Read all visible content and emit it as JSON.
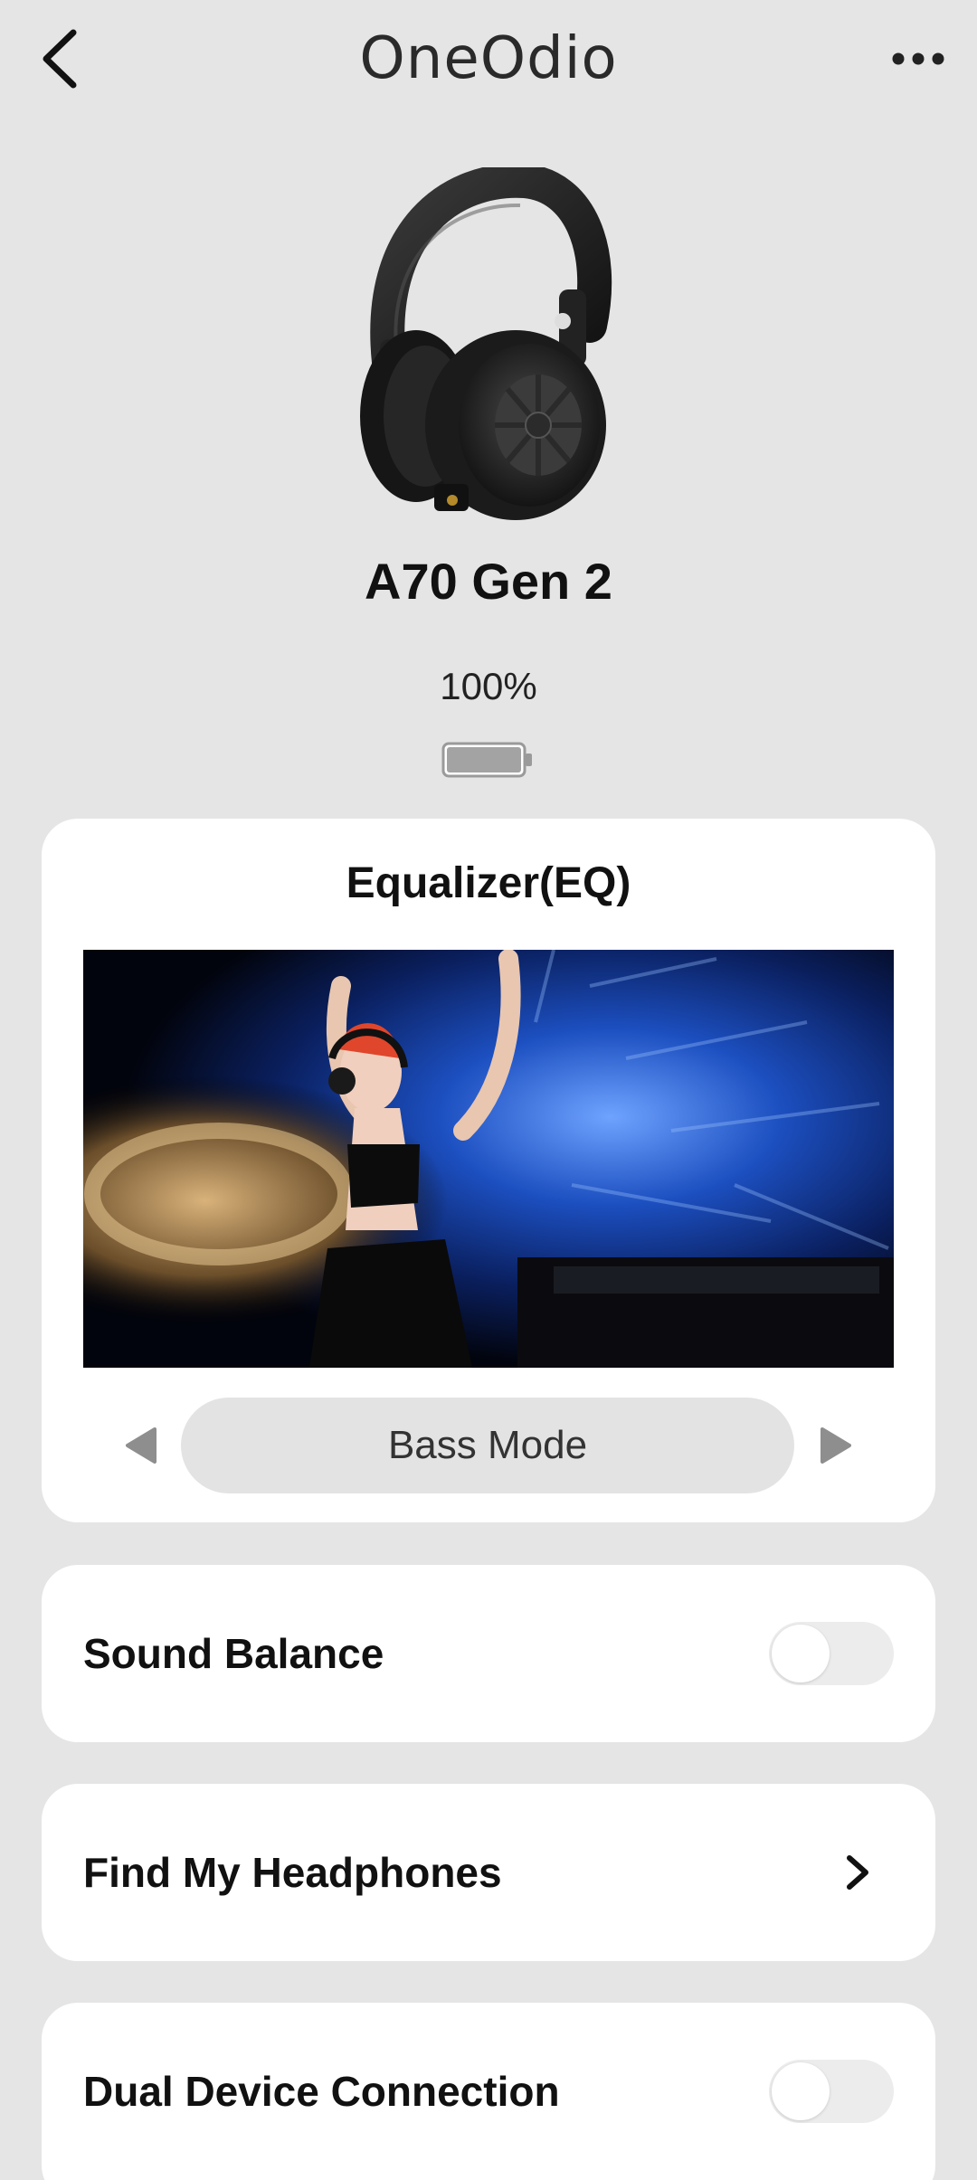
{
  "header": {
    "brand": "OneOdio",
    "back_icon": "chevron-left-icon",
    "more_icon": "more-horizontal-icon"
  },
  "device": {
    "name": "A70 Gen 2",
    "battery_percent_label": "100%",
    "battery_level": 1.0
  },
  "equalizer": {
    "title": "Equalizer(EQ)",
    "mode": "Bass Mode",
    "prev_icon": "triangle-left-icon",
    "next_icon": "triangle-right-icon"
  },
  "settings": {
    "sound_balance": {
      "label": "Sound Balance",
      "enabled": false
    },
    "find_my_headphones": {
      "label": "Find My Headphones"
    },
    "dual_device": {
      "label": "Dual Device Connection",
      "enabled": false
    }
  },
  "colors": {
    "background": "#e5e5e5",
    "card": "#ffffff",
    "pill": "#e3e3e3",
    "text": "#111111",
    "icon_gray": "#9a9a9a"
  }
}
